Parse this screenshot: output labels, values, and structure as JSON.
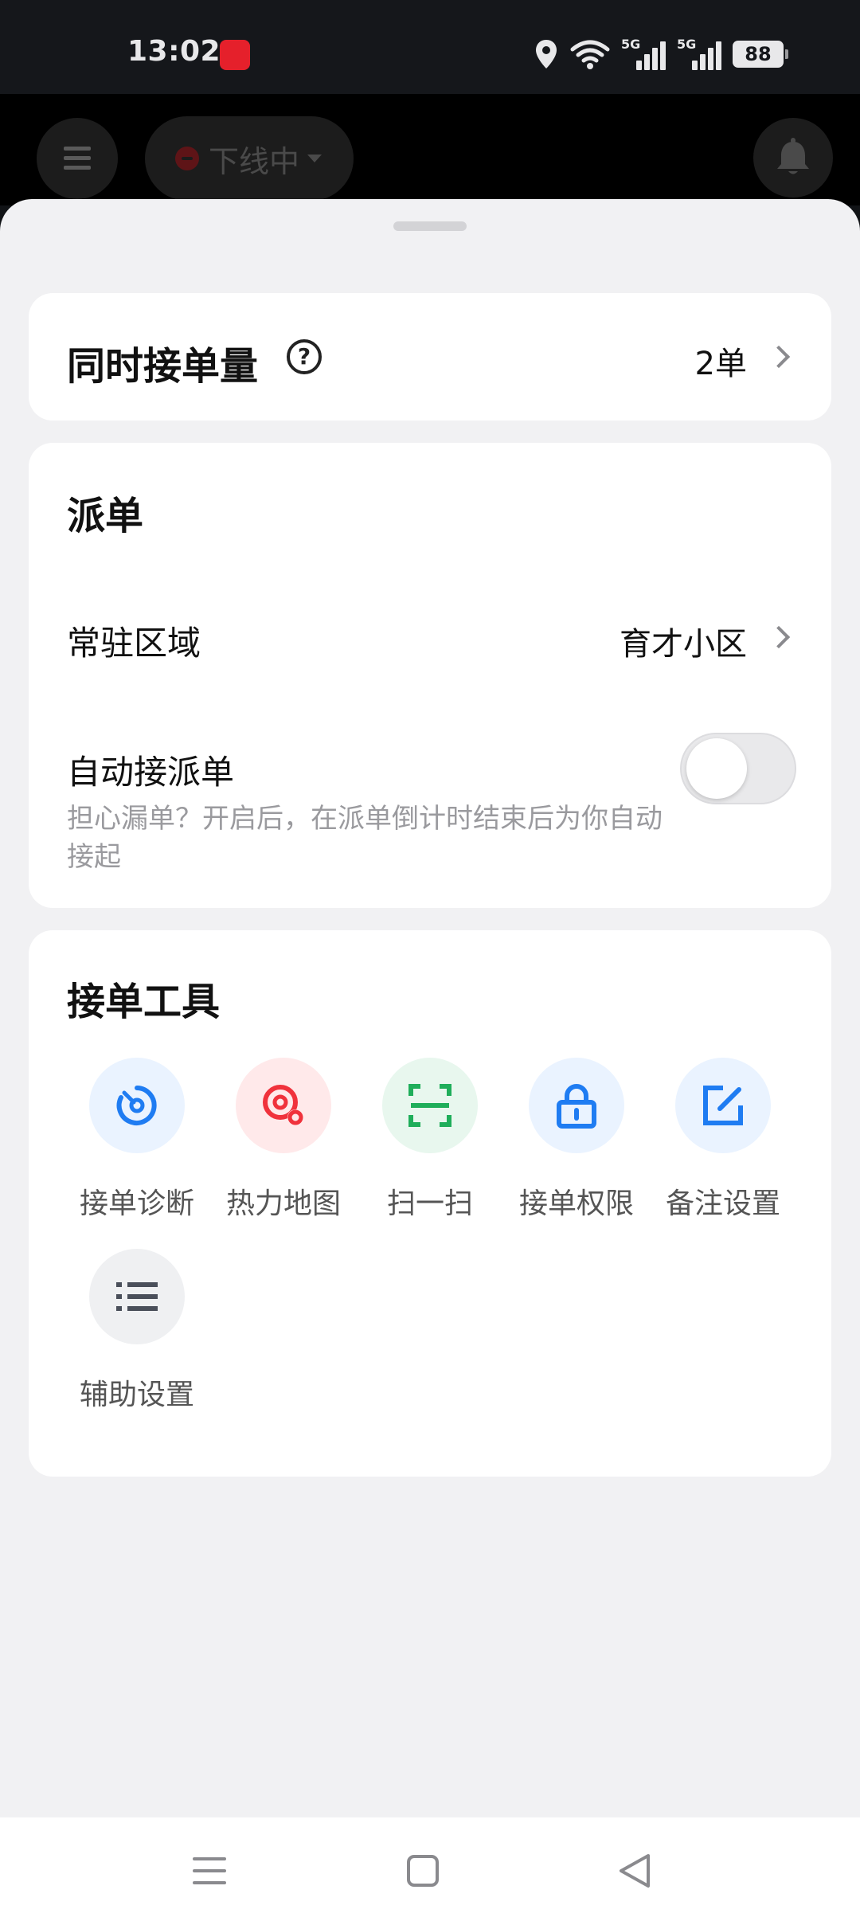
{
  "status_bar": {
    "time": "13:02",
    "battery": "88",
    "network_1": "5G",
    "network_2": "5G"
  },
  "header": {
    "status": "下线中"
  },
  "concurrent": {
    "title": "同时接单量",
    "value": "2单"
  },
  "dispatch": {
    "title": "派单",
    "area_label": "常驻区域",
    "area_value": "育才小区",
    "auto_label": "自动接派单",
    "auto_desc": "担心漏单？开启后，在派单倒计时结束后为你自动接起",
    "auto_enabled": false
  },
  "tools": {
    "title": "接单工具",
    "items": [
      {
        "label": "接单诊断",
        "icon": "diagnosis-icon",
        "color": "#1f7cf2",
        "bg": "#eaf3ff"
      },
      {
        "label": "热力地图",
        "icon": "heatmap-icon",
        "color": "#f0323c",
        "bg": "#ffe9ea"
      },
      {
        "label": "扫一扫",
        "icon": "scan-icon",
        "color": "#1fae5a",
        "bg": "#e8f7ee"
      },
      {
        "label": "接单权限",
        "icon": "lock-icon",
        "color": "#1f7cf2",
        "bg": "#eaf3ff"
      },
      {
        "label": "备注设置",
        "icon": "note-edit-icon",
        "color": "#1f7cf2",
        "bg": "#eaf3ff"
      },
      {
        "label": "辅助设置",
        "icon": "list-icon",
        "color": "#4a4f5a",
        "bg": "#eff0f2"
      }
    ]
  }
}
